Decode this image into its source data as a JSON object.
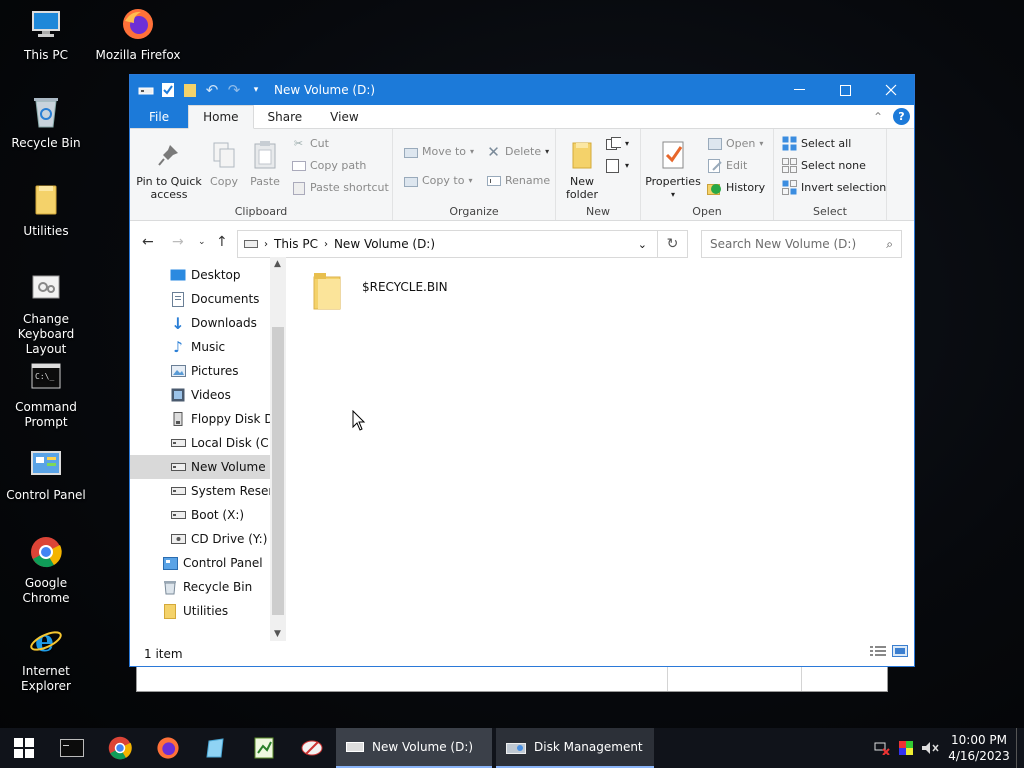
{
  "desktop": {
    "icons": [
      {
        "label": "This PC"
      },
      {
        "label": "Mozilla Firefox"
      },
      {
        "label": "Recycle Bin"
      },
      {
        "label": "Utilities"
      },
      {
        "label": "Change Keyboard Layout"
      },
      {
        "label": "Command Prompt"
      },
      {
        "label": "Control Panel"
      },
      {
        "label": "Google Chrome"
      },
      {
        "label": "Internet Explorer"
      }
    ]
  },
  "window": {
    "title": "New Volume (D:)",
    "tabs": [
      {
        "label": "File"
      },
      {
        "label": "Home"
      },
      {
        "label": "Share"
      },
      {
        "label": "View"
      }
    ],
    "ribbon": {
      "clipboard": {
        "label": "Clipboard",
        "pin": "Pin to Quick access",
        "copy": "Copy",
        "paste": "Paste",
        "cut": "Cut",
        "copy_path": "Copy path",
        "paste_shortcut": "Paste shortcut"
      },
      "organize": {
        "label": "Organize",
        "move_to": "Move to",
        "copy_to": "Copy to",
        "delete": "Delete",
        "rename": "Rename"
      },
      "new": {
        "label": "New",
        "new_folder": "New folder"
      },
      "open": {
        "label": "Open",
        "properties": "Properties",
        "open": "Open",
        "edit": "Edit",
        "history": "History"
      },
      "select": {
        "label": "Select",
        "select_all": "Select all",
        "select_none": "Select none",
        "invert": "Invert selection"
      }
    },
    "address": {
      "crumbs": [
        "This PC",
        "New Volume (D:)"
      ]
    },
    "search": {
      "placeholder": "Search New Volume (D:)"
    },
    "nav_tree": [
      {
        "label": "Desktop"
      },
      {
        "label": "Documents"
      },
      {
        "label": "Downloads"
      },
      {
        "label": "Music"
      },
      {
        "label": "Pictures"
      },
      {
        "label": "Videos"
      },
      {
        "label": "Floppy Disk Drive (A:)"
      },
      {
        "label": "Local Disk (C:)"
      },
      {
        "label": "New Volume (D:)"
      },
      {
        "label": "System Reserved"
      },
      {
        "label": "Boot (X:)"
      },
      {
        "label": "CD Drive (Y:) H"
      },
      {
        "label": "Control Panel"
      },
      {
        "label": "Recycle Bin"
      },
      {
        "label": "Utilities"
      }
    ],
    "files": [
      {
        "name": "$RECYCLE.BIN"
      }
    ],
    "status": "1 item"
  },
  "taskbar": {
    "tasks": [
      {
        "label": "New Volume (D:)"
      },
      {
        "label": "Disk Management"
      }
    ],
    "time": "10:00 PM",
    "date": "4/16/2023"
  },
  "colors": {
    "accent": "#1c7ad9",
    "folder": "#f4d26a",
    "taskbar": "#10131a"
  }
}
